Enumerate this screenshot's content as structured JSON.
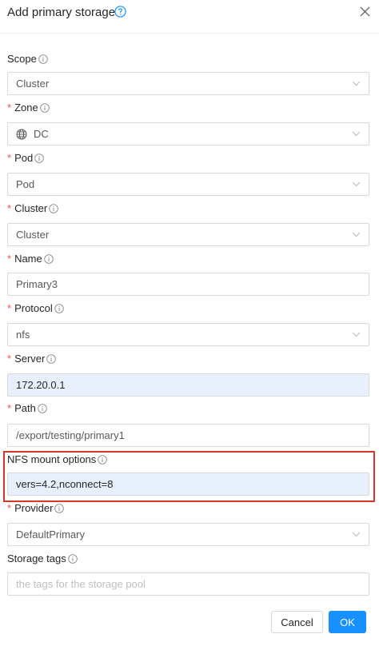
{
  "dialog": {
    "title": "Add primary storage",
    "cancel_label": "Cancel",
    "ok_label": "OK"
  },
  "fields": {
    "scope": {
      "label": "Scope",
      "value": "Cluster"
    },
    "zone": {
      "label": "Zone",
      "value": "DC"
    },
    "pod": {
      "label": "Pod",
      "value": "Pod"
    },
    "cluster": {
      "label": "Cluster",
      "value": "Cluster"
    },
    "name": {
      "label": "Name",
      "value": "Primary3"
    },
    "protocol": {
      "label": "Protocol",
      "value": "nfs"
    },
    "server": {
      "label": "Server",
      "value": "172.20.0.1"
    },
    "path": {
      "label": "Path",
      "value": "/export/testing/primary1"
    },
    "nfs_mount": {
      "label": "NFS mount options",
      "value": "vers=4.2,nconnect=8"
    },
    "provider": {
      "label": "Provider",
      "value": "DefaultPrimary"
    },
    "storage_tags": {
      "label": "Storage tags",
      "placeholder": "the tags for the storage pool"
    }
  },
  "colors": {
    "primary": "#1890ff",
    "required": "#ff4d4f",
    "highlight_border": "#d9352a",
    "filled_bg": "#e8f0fe"
  },
  "icons": {
    "help": "question-circle-icon",
    "close": "close-icon",
    "info": "info-circle-icon",
    "select_arrow": "chevron-down-icon",
    "zone": "globe-icon"
  }
}
